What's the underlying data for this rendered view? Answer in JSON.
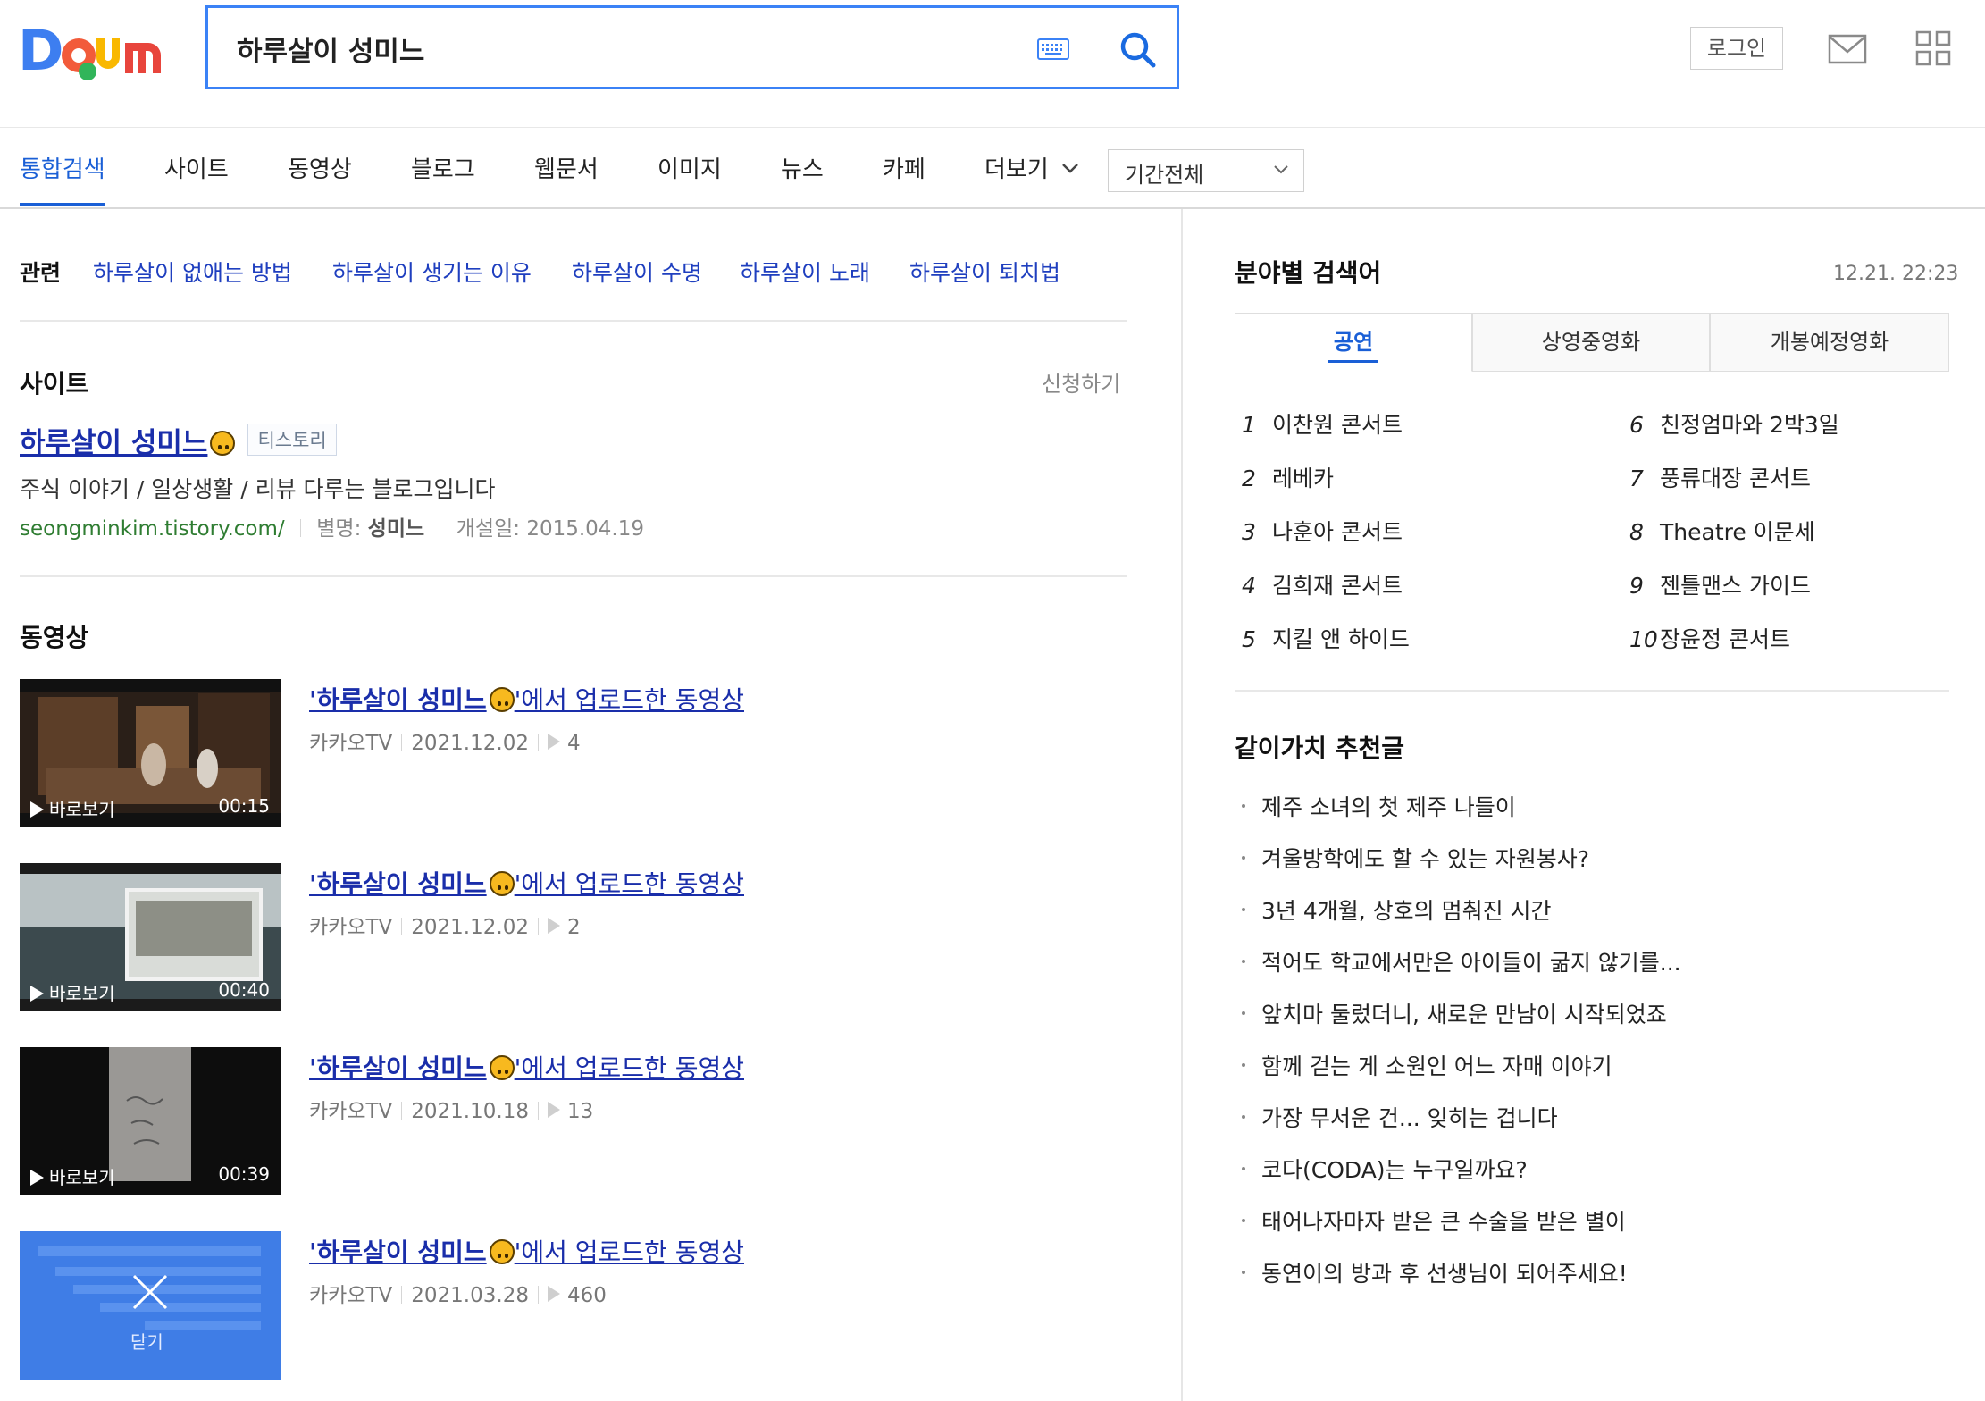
{
  "header": {
    "logo_text": "Daum",
    "search_value": "하루살이 성미느",
    "login_label": "로그인"
  },
  "nav": {
    "tabs": [
      "통합검색",
      "사이트",
      "동영상",
      "블로그",
      "웹문서",
      "이미지",
      "뉴스",
      "카페",
      "더보기"
    ],
    "period": "기간전체"
  },
  "related": {
    "label": "관련",
    "links": [
      "하루살이 없애는 방법",
      "하루살이 생기는 이유",
      "하루살이 수명",
      "하루살이 노래",
      "하루살이 퇴치법"
    ]
  },
  "site": {
    "section_title": "사이트",
    "apply_label": "신청하기",
    "title": "하루살이 성미느",
    "badge": "티스토리",
    "description": "주식 이야기 / 일상생활 / 리뷰 다루는 블로그입니다",
    "url": "seongminkim.tistory.com/",
    "alias_label": "별명:",
    "alias": "성미느",
    "created_label": "개설일:",
    "created": "2015.04.19"
  },
  "videos": {
    "section_title": "동영상",
    "items": [
      {
        "title_bold": "'하루살이 성미느",
        "title_rest": "'에서 업로드한 동영상",
        "source": "카카오TV",
        "date": "2021.12.02",
        "plays": "4",
        "play_label": "바로보기",
        "duration": "00:15"
      },
      {
        "title_bold": "'하루살이 성미느",
        "title_rest": "'에서 업로드한 동영상",
        "source": "카카오TV",
        "date": "2021.12.02",
        "plays": "2",
        "play_label": "바로보기",
        "duration": "00:40"
      },
      {
        "title_bold": "'하루살이 성미느",
        "title_rest": "'에서 업로드한 동영상",
        "source": "카카오TV",
        "date": "2021.10.18",
        "plays": "13",
        "play_label": "바로보기",
        "duration": "00:39"
      },
      {
        "title_bold": "'하루살이 성미느",
        "title_rest": "'에서 업로드한 동영상",
        "source": "카카오TV",
        "date": "2021.03.28",
        "plays": "460",
        "close_label": "닫기"
      }
    ]
  },
  "trending": {
    "title": "분야별 검색어",
    "timestamp": "12.21. 22:23",
    "tabs": [
      "공연",
      "상영중영화",
      "개봉예정영화"
    ],
    "items": [
      {
        "rank": "1",
        "label": "이찬원 콘서트"
      },
      {
        "rank": "2",
        "label": "레베카"
      },
      {
        "rank": "3",
        "label": "나훈아 콘서트"
      },
      {
        "rank": "4",
        "label": "김희재 콘서트"
      },
      {
        "rank": "5",
        "label": "지킬 앤 하이드"
      },
      {
        "rank": "6",
        "label": "친정엄마와 2박3일"
      },
      {
        "rank": "7",
        "label": "풍류대장 콘서트"
      },
      {
        "rank": "8",
        "label": "Theatre 이문세"
      },
      {
        "rank": "9",
        "label": "젠틀맨스 가이드"
      },
      {
        "rank": "10",
        "label": "장윤정 콘서트"
      }
    ]
  },
  "recommend": {
    "title": "같이가치 추천글",
    "items": [
      "제주 소녀의 첫 제주 나들이",
      "겨울방학에도 할 수 있는 자원봉사?",
      "3년 4개월, 상호의 멈춰진 시간",
      "적어도 학교에서만은 아이들이 굶지 않기를...",
      "앞치마 둘렀더니, 새로운 만남이 시작되었죠",
      "함께 걷는 게 소원인 어느 자매 이야기",
      "가장 무서운 건... 잊히는 겁니다",
      "코다(CODA)는 누구일까요?",
      "태어나자마자 받은 큰 수술을 받은 별이",
      "동연이의 방과 후 선생님이 되어주세요!"
    ]
  },
  "colors": {
    "accent": "#1a5fd6",
    "link": "#1a2eaa",
    "url_green": "#2f7d32"
  }
}
